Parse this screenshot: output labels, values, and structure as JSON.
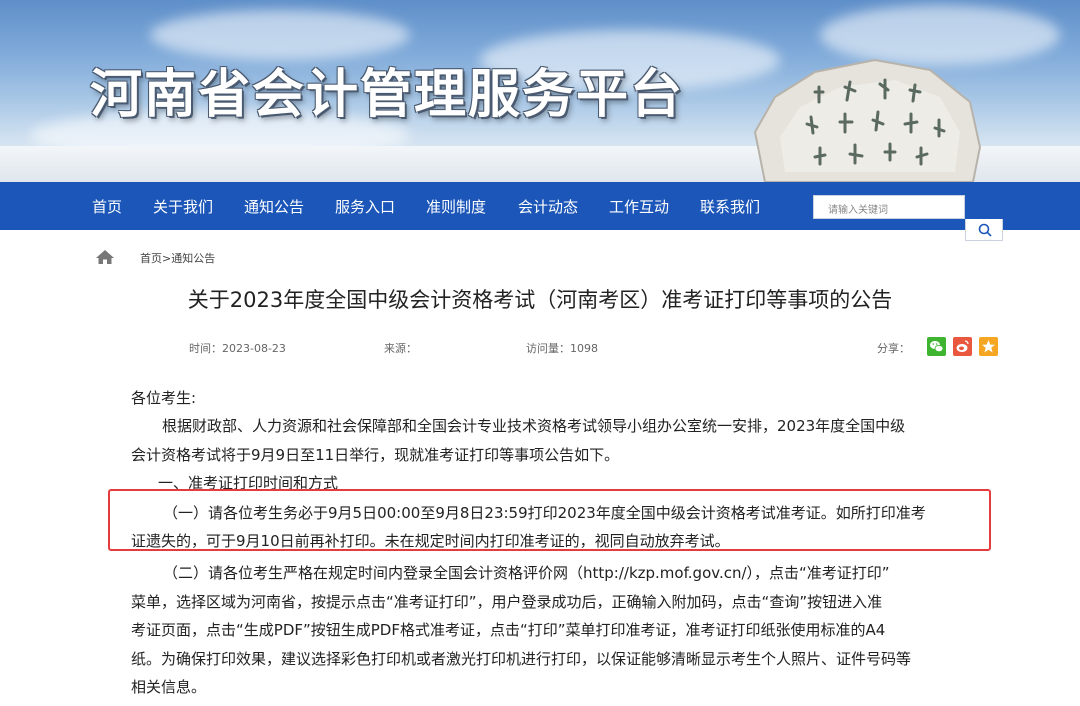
{
  "site": {
    "title": "河南省会计管理服务平台"
  },
  "nav": {
    "items": [
      {
        "label": "首页"
      },
      {
        "label": "关于我们"
      },
      {
        "label": "通知公告"
      },
      {
        "label": "服务入口"
      },
      {
        "label": "准则制度"
      },
      {
        "label": "会计动态"
      },
      {
        "label": "工作互动"
      },
      {
        "label": "联系我们"
      }
    ],
    "search_placeholder": "请输入关键词"
  },
  "breadcrumb": "首页>通知公告",
  "article": {
    "title": "关于2023年度全国中级会计资格考试（河南考区）准考证打印等事项的公告",
    "meta": {
      "time": "时间：2023-08-23",
      "source": "来源：",
      "visits": "访问量：1098",
      "share_label": "分享："
    },
    "lines": [
      "各位考生:",
      "根据财政部、人力资源和社会保障部和全国会计专业技术资格考试领导小组办公室统一安排，2023年度全国中级",
      "会计资格考试将于9月9日至11日举行，现就准考证打印等事项公告如下。",
      "一、准考证打印时间和方式",
      "（一）请各位考生务必于9月5日00:00至9月8日23:59打印2023年度全国中级会计资格考试准考证。如所打印准考",
      "证遗失的，可于9月10日前再补打印。未在规定时间内打印准考证的，视同自动放弃考试。",
      "（二）请各位考生严格在规定时间内登录全国会计资格评价网（http://kzp.mof.gov.cn/），点击“准考证打印”",
      "菜单，选择区域为河南省，按提示点击“准考证打印”，用户登录成功后，正确输入附加码，点击“查询”按钮进入准",
      "考证页面，点击“生成PDF”按钮生成PDF格式准考证，点击“打印”菜单打印准考证，准考证打印纸张使用标准的A4",
      "纸。为确保打印效果，建议选择彩色打印机或者激光打印机进行打印，以保证能够清晰显示考生个人照片、证件号码等",
      "相关信息。"
    ]
  },
  "share_buttons": [
    {
      "name": "wechat",
      "color": "#3fb431"
    },
    {
      "name": "weibo",
      "color": "#e9573f"
    },
    {
      "name": "qzone",
      "color": "#f5a623"
    }
  ]
}
